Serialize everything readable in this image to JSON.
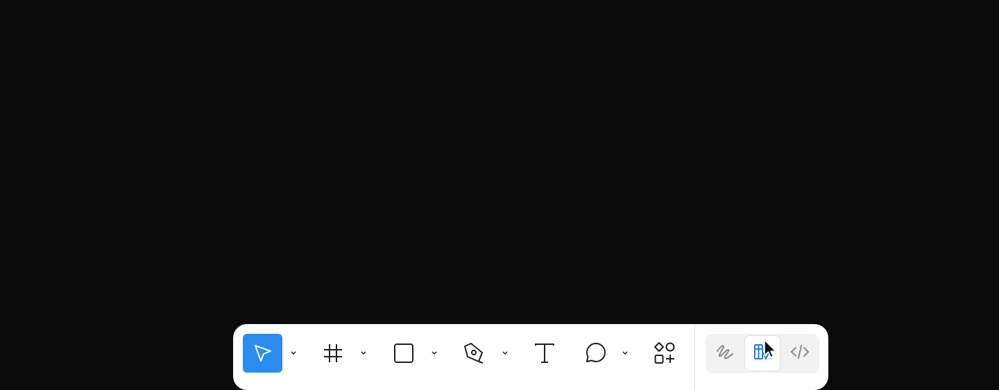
{
  "toolbar": {
    "tools": [
      {
        "id": "move",
        "icon": "move-pointer-icon",
        "active": true,
        "has_menu": true
      },
      {
        "id": "frame",
        "icon": "frame-hash-icon",
        "active": false,
        "has_menu": true
      },
      {
        "id": "shape",
        "icon": "rectangle-icon",
        "active": false,
        "has_menu": true
      },
      {
        "id": "pen",
        "icon": "pen-nib-icon",
        "active": false,
        "has_menu": true
      },
      {
        "id": "text",
        "icon": "text-t-icon",
        "active": false,
        "has_menu": false
      },
      {
        "id": "comment",
        "icon": "comment-bubble-icon",
        "active": false,
        "has_menu": true
      },
      {
        "id": "actions",
        "icon": "shapes-plus-icon",
        "active": false,
        "has_menu": false
      }
    ],
    "modes": [
      {
        "id": "draw",
        "icon": "scribble-icon",
        "selected": false
      },
      {
        "id": "design",
        "icon": "design-mode-icon",
        "selected": true
      },
      {
        "id": "dev",
        "icon": "code-brackets-icon",
        "selected": false
      }
    ]
  },
  "colors": {
    "canvas_background": "#0b0b0b",
    "toolbar_background": "#ffffff",
    "active_tool": "#2b8cf0",
    "accent_blue": "#1f7fe0",
    "icon_dark": "#1e1e1e",
    "icon_gray": "#8a8a8a"
  }
}
